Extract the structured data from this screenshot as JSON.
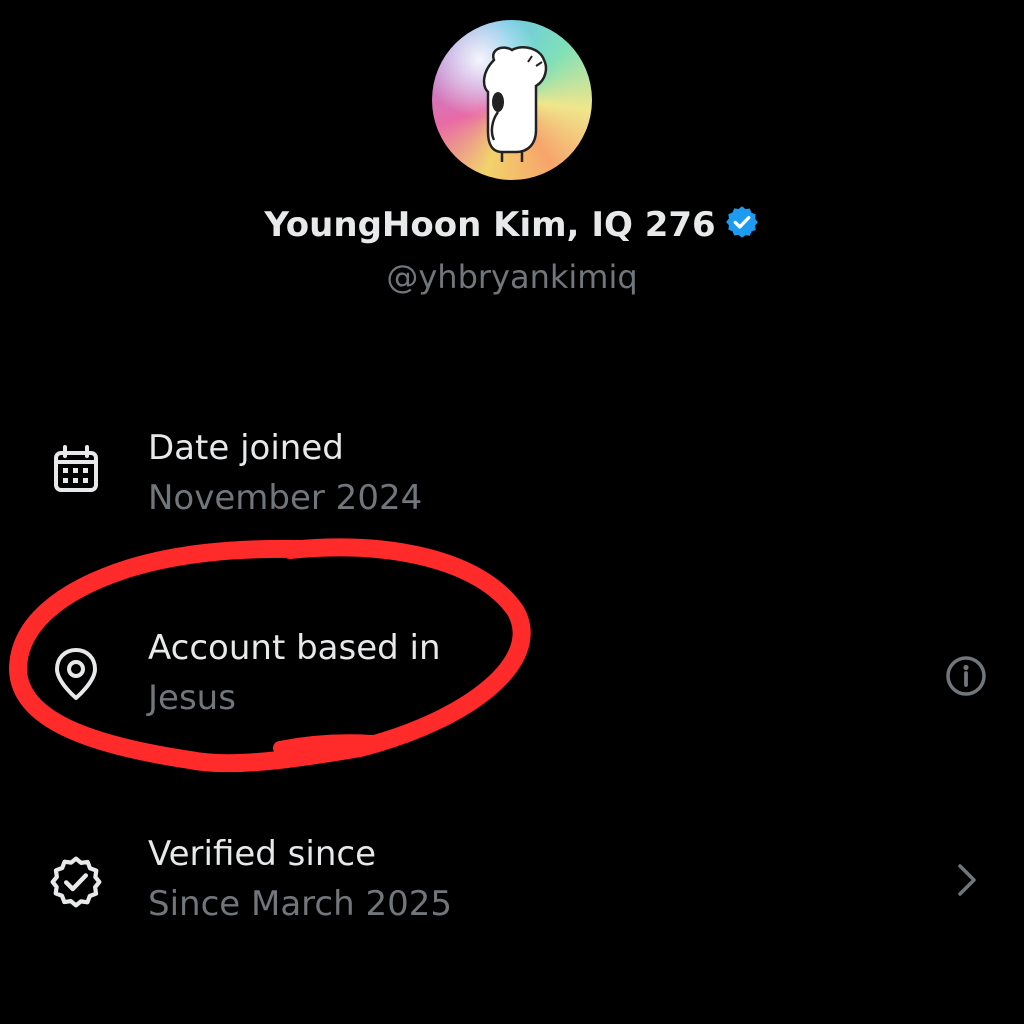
{
  "profile": {
    "display_name": "YoungHoon Kim, IQ 276",
    "handle": "@yhbryankimiq",
    "avatar_icon": "cartoon-character-avatar",
    "verified_icon": "verified-badge-icon"
  },
  "details": [
    {
      "icon": "calendar-icon",
      "label": "Date joined",
      "value": "November 2024",
      "trailing": ""
    },
    {
      "icon": "location-pin-icon",
      "label": "Account based in",
      "value": "Jesus",
      "trailing": "info-icon"
    },
    {
      "icon": "verified-check-icon",
      "label": "Verified since",
      "value": "Since March 2025",
      "trailing": "chevron-right-icon"
    }
  ],
  "colors": {
    "background": "#000000",
    "primary_text": "#e7e9ea",
    "secondary_text": "#71767b",
    "verified_blue": "#1d9bf0",
    "annotation_red": "#ff2a2a"
  }
}
